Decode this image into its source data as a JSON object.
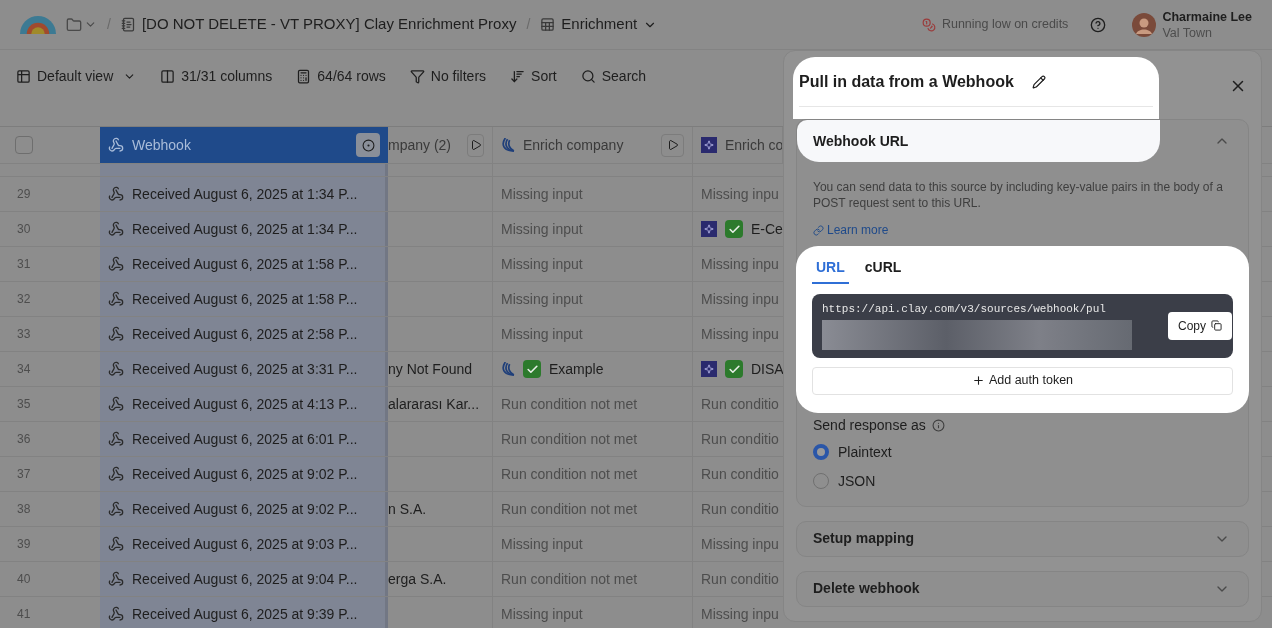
{
  "header": {
    "breadcrumb": [
      {
        "kind": "folder"
      },
      {
        "kind": "workbook",
        "separator": "/",
        "label": "[DO NOT DELETE - VT PROXY] Clay Enrichment Proxy"
      },
      {
        "kind": "table",
        "separator": "/",
        "label": "Enrichment"
      }
    ],
    "credits_warning": "Running low on credits",
    "user": {
      "name": "Charmaine Lee",
      "workspace": "Val Town"
    }
  },
  "toolbar": [
    {
      "kind": "view",
      "label": "Default view"
    },
    {
      "kind": "columns",
      "label": "31/31 columns"
    },
    {
      "kind": "rows",
      "label": "64/64 rows"
    },
    {
      "kind": "filter",
      "label": "No filters"
    },
    {
      "kind": "sort",
      "label": "Sort"
    },
    {
      "kind": "search",
      "label": "Search"
    }
  ],
  "table": {
    "select_all": {
      "checked": false
    },
    "columns": [
      {
        "kind": "webhook",
        "label": "Webhook",
        "selected": true
      },
      {
        "kind": "formula",
        "label": "mpany (2)",
        "selected": false
      },
      {
        "kind": "enrich_a",
        "label": "Enrich company",
        "selected": false
      },
      {
        "kind": "enrich_b",
        "label": "Enrich co",
        "selected": false
      }
    ],
    "rows": [
      {
        "number": "29",
        "cells": [
          {
            "kind": "webhook",
            "text": "Received August 6, 2025 at 1:34 P..."
          },
          {
            "kind": "empty"
          },
          {
            "kind": "status",
            "text": "Missing input"
          },
          {
            "kind": "status",
            "text": "Missing inpu"
          }
        ]
      },
      {
        "number": "30",
        "cells": [
          {
            "kind": "webhook",
            "text": "Received August 6, 2025 at 1:34 P..."
          },
          {
            "kind": "empty"
          },
          {
            "kind": "status",
            "text": "Missing input"
          },
          {
            "kind": "result",
            "text": "E-Ce"
          }
        ]
      },
      {
        "number": "31",
        "cells": [
          {
            "kind": "webhook",
            "text": "Received August 6, 2025 at 1:58 P..."
          },
          {
            "kind": "empty"
          },
          {
            "kind": "status",
            "text": "Missing input"
          },
          {
            "kind": "status",
            "text": "Missing inpu"
          }
        ]
      },
      {
        "number": "32",
        "cells": [
          {
            "kind": "webhook",
            "text": "Received August 6, 2025 at 1:58 P..."
          },
          {
            "kind": "empty"
          },
          {
            "kind": "status",
            "text": "Missing input"
          },
          {
            "kind": "status",
            "text": "Missing inpu"
          }
        ]
      },
      {
        "number": "33",
        "cells": [
          {
            "kind": "webhook",
            "text": "Received August 6, 2025 at 2:58 P..."
          },
          {
            "kind": "empty"
          },
          {
            "kind": "status",
            "text": "Missing input"
          },
          {
            "kind": "status",
            "text": "Missing inpu"
          }
        ]
      },
      {
        "number": "34",
        "cells": [
          {
            "kind": "webhook",
            "text": "Received August 6, 2025 at 3:31 P..."
          },
          {
            "kind": "text",
            "text": "ny Not Found"
          },
          {
            "kind": "result",
            "text": "Example"
          },
          {
            "kind": "result",
            "text": "DISA"
          }
        ]
      },
      {
        "number": "35",
        "cells": [
          {
            "kind": "webhook",
            "text": "Received August 6, 2025 at 4:13 P..."
          },
          {
            "kind": "text",
            "text": "alararası Kar..."
          },
          {
            "kind": "status",
            "text": "Run condition not met"
          },
          {
            "kind": "status",
            "text": "Run conditio"
          }
        ]
      },
      {
        "number": "36",
        "cells": [
          {
            "kind": "webhook",
            "text": "Received August 6, 2025 at 6:01 P..."
          },
          {
            "kind": "empty"
          },
          {
            "kind": "status",
            "text": "Run condition not met"
          },
          {
            "kind": "status",
            "text": "Run conditio"
          }
        ]
      },
      {
        "number": "37",
        "cells": [
          {
            "kind": "webhook",
            "text": "Received August 6, 2025 at 9:02 P..."
          },
          {
            "kind": "empty"
          },
          {
            "kind": "status",
            "text": "Run condition not met"
          },
          {
            "kind": "status",
            "text": "Run conditio"
          }
        ]
      },
      {
        "number": "38",
        "cells": [
          {
            "kind": "webhook",
            "text": "Received August 6, 2025 at 9:02 P..."
          },
          {
            "kind": "text",
            "text": "n S.A."
          },
          {
            "kind": "status",
            "text": "Run condition not met"
          },
          {
            "kind": "status",
            "text": "Run conditio"
          }
        ]
      },
      {
        "number": "39",
        "cells": [
          {
            "kind": "webhook",
            "text": "Received August 6, 2025 at 9:03 P..."
          },
          {
            "kind": "empty"
          },
          {
            "kind": "status",
            "text": "Missing input"
          },
          {
            "kind": "status",
            "text": "Missing inpu"
          }
        ]
      },
      {
        "number": "40",
        "cells": [
          {
            "kind": "webhook",
            "text": "Received August 6, 2025 at 9:04 P..."
          },
          {
            "kind": "text",
            "text": "erga S.A."
          },
          {
            "kind": "status",
            "text": "Run condition not met"
          },
          {
            "kind": "status",
            "text": "Run conditio"
          }
        ]
      },
      {
        "number": "41",
        "cells": [
          {
            "kind": "webhook",
            "text": "Received August 6, 2025 at 9:39 P..."
          },
          {
            "kind": "empty"
          },
          {
            "kind": "status",
            "text": "Missing input"
          },
          {
            "kind": "status",
            "text": "Missing inpu"
          }
        ]
      }
    ]
  },
  "panel": {
    "title": "Pull in data from a Webhook",
    "title_spotlight": true,
    "sections": [
      {
        "title": "Webhook URL",
        "expanded": true
      },
      {
        "title": "Setup mapping",
        "expanded": false
      },
      {
        "title": "Delete webhook",
        "expanded": false
      }
    ],
    "description": "You can send data to this source by including key-value pairs in the body of a POST request sent to this URL.",
    "link": "Learn more",
    "url_block": {
      "spotlight": true,
      "tabs": [
        {
          "label": "URL",
          "selected": true
        },
        {
          "label": "cURL",
          "selected": false
        }
      ],
      "url": "https://api.clay.com/v3/sources/webhook/pul",
      "copy": "Copy",
      "add_token": "Add auth token"
    },
    "response": {
      "label": "Send response as",
      "options": [
        {
          "label": "Plaintext",
          "selected": true
        },
        {
          "label": "JSON",
          "selected": false
        }
      ]
    }
  }
}
